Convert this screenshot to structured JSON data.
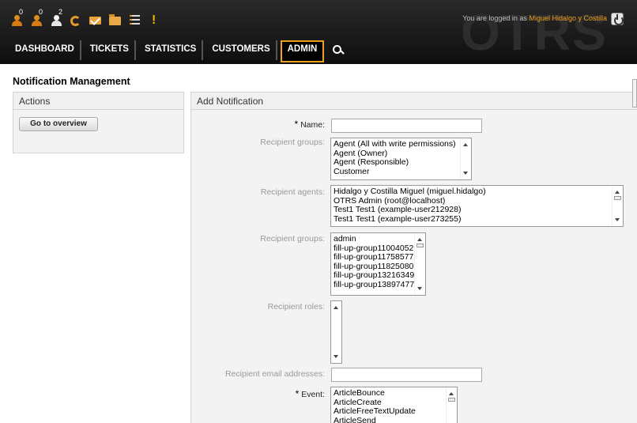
{
  "header": {
    "toolbar": [
      {
        "icon": "locked-tickets-icon",
        "count": "0"
      },
      {
        "icon": "watched-tickets-icon",
        "count": "0"
      },
      {
        "icon": "responsible-tickets-icon",
        "count": "2"
      },
      {
        "icon": "refresh-icon",
        "count": ""
      },
      {
        "icon": "new-mail-icon",
        "count": ""
      },
      {
        "icon": "folder-icon",
        "count": ""
      },
      {
        "icon": "queue-view-icon",
        "count": ""
      },
      {
        "icon": "escalation-icon",
        "count": ""
      }
    ],
    "login_prefix": "You are logged in as",
    "login_user": "Miguel Hidalgo y Costilla",
    "logo": "OTRS",
    "accent": "#f0a020"
  },
  "nav": {
    "items": [
      "DASHBOARD",
      "TICKETS",
      "STATISTICS",
      "CUSTOMERS",
      "ADMIN"
    ],
    "active": "ADMIN"
  },
  "page": {
    "title": "Notification Management"
  },
  "actions": {
    "title": "Actions",
    "overview_button": "Go to overview"
  },
  "form": {
    "title": "Add Notification",
    "name_label": "Name:",
    "name_value": "",
    "recipient_groups_label": "Recipient groups:",
    "recipient_groups_options": [
      "Agent (All with write permissions)",
      "Agent (Owner)",
      "Agent (Responsible)",
      "Customer"
    ],
    "recipient_agents_label": "Recipient agents:",
    "recipient_agents_options": [
      "Hidalgo y Costilla Miguel (miguel.hidalgo)",
      "OTRS Admin (root@localhost)",
      "Test1 Test1 (example-user212928)",
      "Test1 Test1 (example-user273255)"
    ],
    "recipient_groups2_label": "Recipient groups:",
    "recipient_groups2_options": [
      "admin",
      "fill-up-group11004052",
      "fill-up-group11758577",
      "fill-up-group11825080",
      "fill-up-group13216349",
      "fill-up-group13897477"
    ],
    "recipient_roles_label": "Recipient roles:",
    "recipient_email_label": "Recipient email addresses:",
    "recipient_email_value": "",
    "event_label": "Event:",
    "event_options": [
      "ArticleBounce",
      "ArticleCreate",
      "ArticleFreeTextUpdate",
      "ArticleSend"
    ]
  }
}
